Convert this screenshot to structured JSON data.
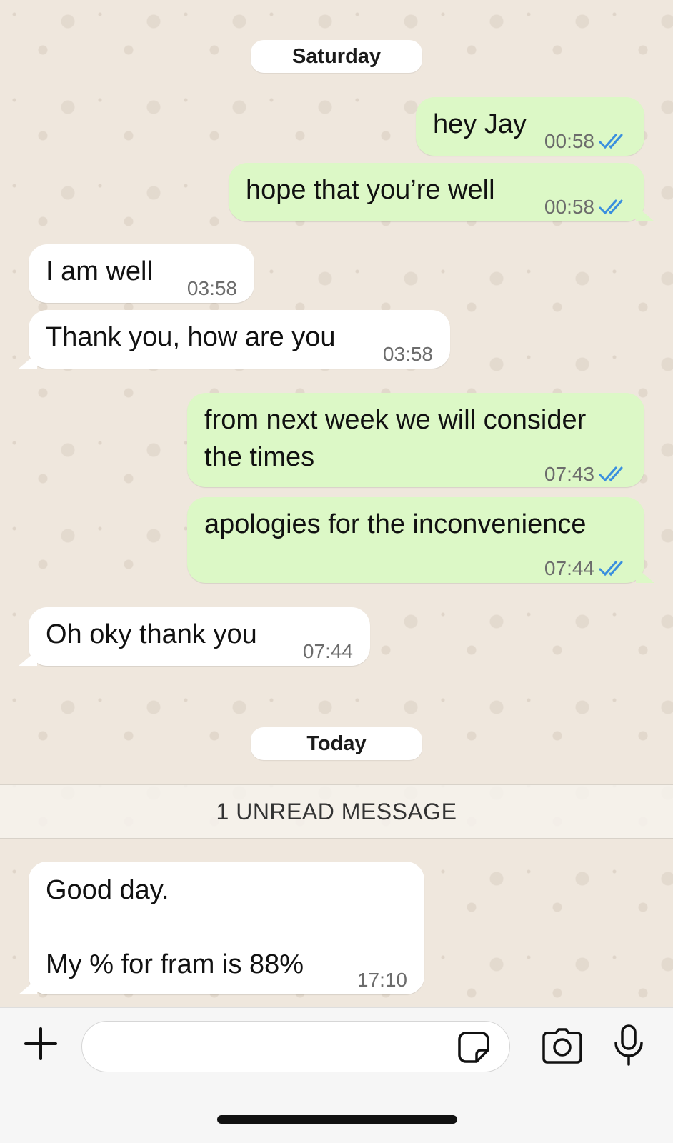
{
  "chat": {
    "date_saturday": "Saturday",
    "date_today": "Today",
    "unread_banner": "1 UNREAD MESSAGE",
    "messages": [
      {
        "direction": "out",
        "lines": [
          "hey Jay"
        ],
        "time": "00:58",
        "status": "read"
      },
      {
        "direction": "out",
        "lines": [
          "hope that you’re well"
        ],
        "time": "00:58",
        "status": "read"
      },
      {
        "direction": "in",
        "lines": [
          "I am well"
        ],
        "time": "03:58"
      },
      {
        "direction": "in",
        "lines": [
          "Thank you, how are you"
        ],
        "time": "03:58"
      },
      {
        "direction": "out",
        "lines": [
          "from next week we will consider",
          "the times"
        ],
        "time": "07:43",
        "status": "read"
      },
      {
        "direction": "out",
        "lines": [
          "apologies for the inconvenience"
        ],
        "time": "07:44",
        "status": "read"
      },
      {
        "direction": "in",
        "lines": [
          "Oh oky thank you"
        ],
        "time": "07:44"
      },
      {
        "direction": "in",
        "lines": [
          "Good day.",
          "",
          "My % for fram is 88%"
        ],
        "time": "17:10"
      }
    ]
  },
  "input_bar": {
    "message_placeholder": "",
    "icons": [
      "plus-icon",
      "sticker-icon",
      "camera-icon",
      "microphone-icon"
    ]
  },
  "colors": {
    "outgoing_bubble": "#dcf8c6",
    "incoming_bubble": "#ffffff",
    "read_ticks": "#3a8fde",
    "wallpaper": "#efe7dd"
  }
}
